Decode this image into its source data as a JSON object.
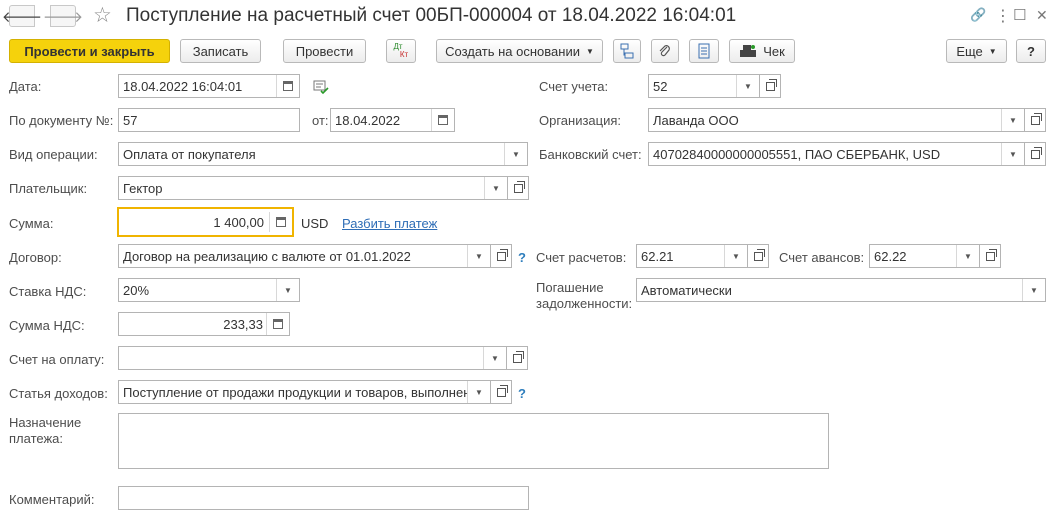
{
  "window": {
    "title": "Поступление на расчетный счет 00БП-000004 от 18.04.2022 16:04:01",
    "back_glyph": "🡐",
    "forward_glyph": "🡒",
    "star_glyph": "☆",
    "link_glyph": "🔗",
    "menu_glyph": "⋮",
    "maximize_glyph": "☐",
    "close_glyph": "✕"
  },
  "toolbar": {
    "post_close": "Провести и закрыть",
    "save": "Записать",
    "post": "Провести",
    "dtkt_top": "Дт",
    "dtkt_bottom": "Кт",
    "create_basis": "Создать на основании",
    "check": "Чек",
    "more": "Еще",
    "help": "?"
  },
  "form": {
    "date_label": "Дата:",
    "date_value": "18.04.2022 16:04:01",
    "doc_number_label": "По документу №:",
    "doc_number_value": "57",
    "doc_date_label": "от:",
    "doc_date_value": "18.04.2022",
    "operation_label": "Вид операции:",
    "operation_value": "Оплата от покупателя",
    "payer_label": "Плательщик:",
    "payer_value": "Гектор",
    "sum_label": "Сумма:",
    "sum_value": "1 400,00",
    "currency": "USD",
    "split_link": "Разбить платеж",
    "contract_label": "Договор:",
    "contract_value": "Договор на реализацию с валюте от 01.01.2022",
    "vat_rate_label": "Ставка НДС:",
    "vat_rate_value": "20%",
    "vat_sum_label": "Сумма НДС:",
    "vat_sum_value": "233,33",
    "invoice_label": "Счет на оплату:",
    "invoice_value": "",
    "income_item_label": "Статья доходов:",
    "income_item_value": "Поступление от продажи продукции и товаров, выполнен",
    "purpose_label_1": "Назначение",
    "purpose_label_2": "платежа:",
    "purpose_value": "",
    "comment_label": "Комментарий:",
    "comment_value": "",
    "account_label": "Счет учета:",
    "account_value": "52",
    "org_label": "Организация:",
    "org_value": "Лаванда ООО",
    "bank_label": "Банковский счет:",
    "bank_value": "40702840000000005551, ПАО СБЕРБАНК, USD",
    "settle_label": "Счет расчетов:",
    "settle_value": "62.21",
    "advance_label": "Счет авансов:",
    "advance_value": "62.22",
    "debt_label_1": "Погашение",
    "debt_label_2": "задолженности:",
    "debt_value": "Автоматически",
    "help_q": "?"
  },
  "colors": {
    "primary_button": "#f5d20c",
    "focus_border": "#f0b400",
    "link": "#2e6db6"
  }
}
